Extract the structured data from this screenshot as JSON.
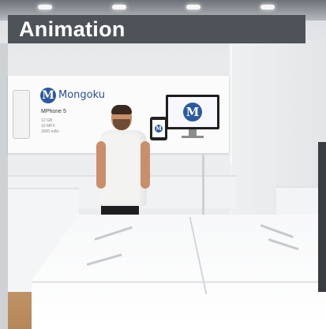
{
  "header": {
    "title": "Animation"
  },
  "scene": {
    "brand": {
      "logo_letter": "M",
      "name": "Mongoku"
    },
    "product": {
      "name": "MPhone 5",
      "specs": [
        "12 GB",
        "10 MPX",
        "2000 mAh"
      ]
    }
  },
  "colors": {
    "title_bar": "#4d5359",
    "title_text": "#ffffff",
    "brand_blue": "#2c5aa0"
  }
}
